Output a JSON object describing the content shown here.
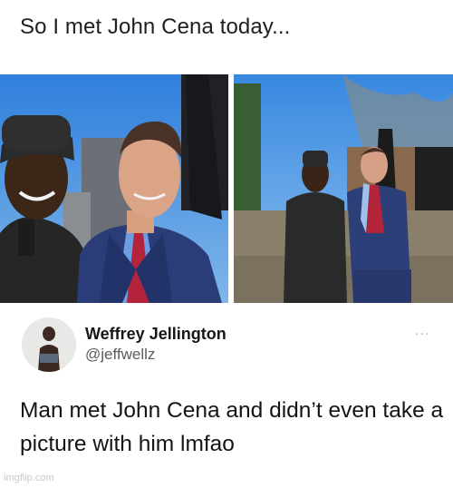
{
  "caption": "So I met John Cena today...",
  "photos": {
    "left_alt": "Cook in black chef uniform posing with man in navy suit and red tie, close-up",
    "right_alt": "Same two men photographed full-length on an outdoor patio"
  },
  "tweet": {
    "display_name": "Weffrey Jellington",
    "handle": "@jeffwellz",
    "more_label": "...",
    "text": "Man met John Cena and didn’t even take a picture with him lmfao"
  },
  "watermark": "imgflip.com",
  "colors": {
    "sky": "#3b8be0",
    "suit": "#2c3f78",
    "tie": "#b3243a",
    "chef": "#2a2a2a"
  }
}
